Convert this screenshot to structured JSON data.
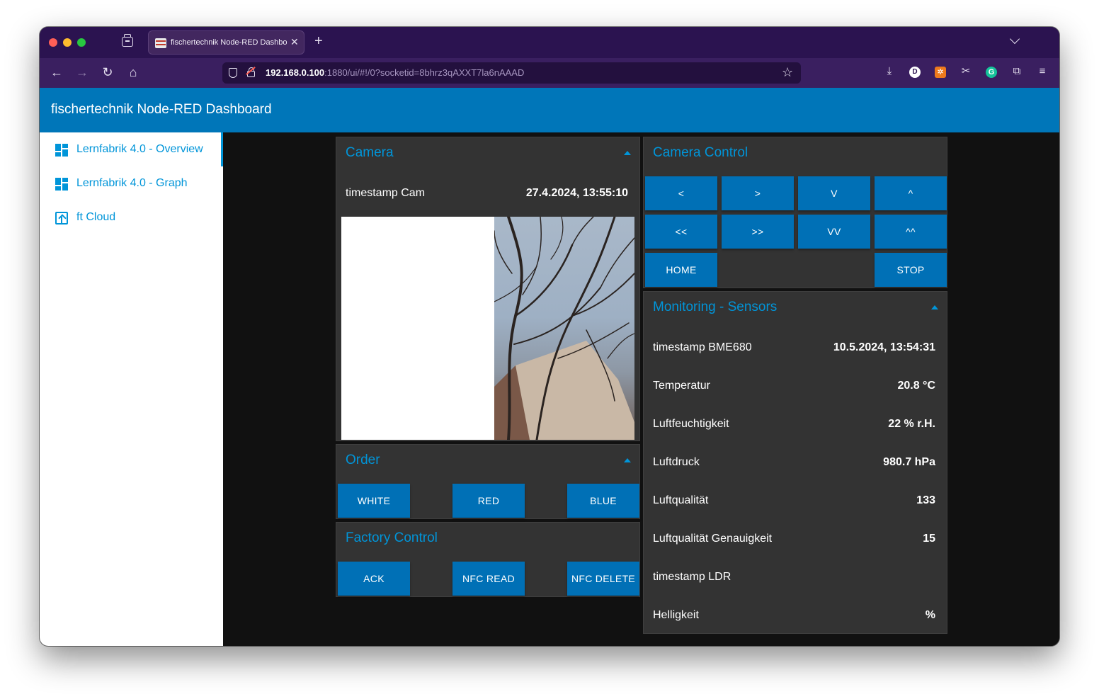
{
  "browser": {
    "tab_title": "fischertechnik Node-RED Dashboard",
    "url_host": "192.168.0.100",
    "url_rest": ":1880/ui/#!/0?socketid=8bhrz3qAXXT7la6nAAAD",
    "ext_d_label": "D",
    "ext_g_label": "G"
  },
  "header": {
    "title": "fischertechnik Node-RED Dashboard"
  },
  "sidebar": {
    "items": [
      {
        "label": "Lernfabrik 4.0 - Overview",
        "icon": "dashboard-icon"
      },
      {
        "label": "Lernfabrik 4.0 - Graph",
        "icon": "dashboard-icon"
      },
      {
        "label": "ft Cloud",
        "icon": "open-in-browser-icon"
      }
    ]
  },
  "camera": {
    "title": "Camera",
    "timestamp_label": "timestamp Cam",
    "timestamp_value": "27.4.2024, 13:55:10"
  },
  "order": {
    "title": "Order",
    "buttons": [
      "WHITE",
      "RED",
      "BLUE"
    ]
  },
  "factory_control": {
    "title": "Factory Control",
    "buttons": [
      "ACK",
      "NFC READ",
      "NFC DELETE"
    ]
  },
  "camera_control": {
    "title": "Camera Control",
    "row1": [
      "<",
      ">",
      "V",
      "^"
    ],
    "row2": [
      "<<",
      ">>",
      "VV",
      "^^"
    ],
    "home": "HOME",
    "stop": "STOP"
  },
  "sensors": {
    "title": "Monitoring - Sensors",
    "rows": [
      {
        "label": "timestamp BME680",
        "value": "10.5.2024, 13:54:31"
      },
      {
        "label": "Temperatur",
        "value": "20.8 °C"
      },
      {
        "label": "Luftfeuchtigkeit",
        "value": "22 % r.H."
      },
      {
        "label": "Luftdruck",
        "value": "980.7 hPa"
      },
      {
        "label": "Luftqualität",
        "value": "133"
      },
      {
        "label": "Luftqualität Genauigkeit",
        "value": "15"
      },
      {
        "label": "timestamp LDR",
        "value": ""
      },
      {
        "label": "Helligkeit",
        "value": "%"
      }
    ]
  },
  "colors": {
    "accent": "#0095d9",
    "header_bg": "#0076b9",
    "button_bg": "#0070b6",
    "card_bg": "#333333",
    "content_bg": "#111111"
  }
}
